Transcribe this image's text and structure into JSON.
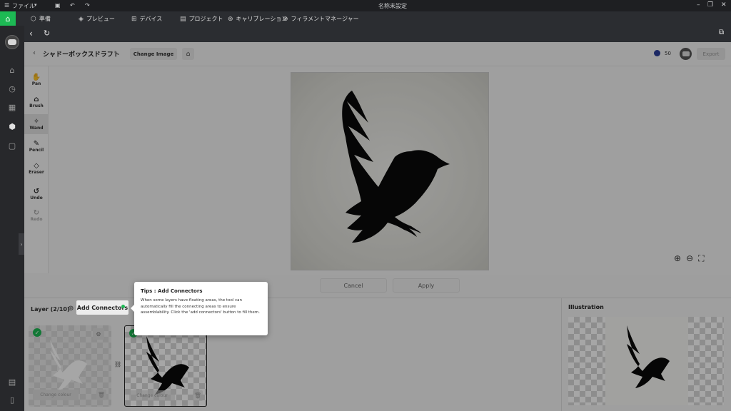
{
  "titlebar": {
    "menu_label": "ファイル",
    "window_title": "名称未設定"
  },
  "menubar": {
    "tabs": [
      {
        "label": "準備",
        "icon": "box-icon"
      },
      {
        "label": "プレビュー",
        "icon": "layers-icon"
      },
      {
        "label": "デバイス",
        "icon": "device-icon"
      },
      {
        "label": "プロジェクト",
        "icon": "project-icon"
      },
      {
        "label": "キャリブレーション",
        "icon": "calibration-icon"
      },
      {
        "label": "フィラメントマネージャー",
        "icon": "filament-icon"
      }
    ]
  },
  "toolbar": {
    "title": "シャドーボックスドラフト",
    "change_image": "Change Image",
    "credits": "50",
    "export": "Export"
  },
  "tools": [
    {
      "label": "Pan",
      "icon": "hand-icon"
    },
    {
      "label": "Brush",
      "icon": "brush-icon"
    },
    {
      "label": "Wand",
      "icon": "wand-icon"
    },
    {
      "label": "Pencil",
      "icon": "pencil-icon"
    },
    {
      "label": "Eraser",
      "icon": "eraser-icon"
    },
    {
      "label": "Undo",
      "icon": "undo-icon"
    },
    {
      "label": "Redo",
      "icon": "redo-icon"
    }
  ],
  "actions": {
    "cancel": "Cancel",
    "apply": "Apply"
  },
  "layers": {
    "title": "Layer (2/10)",
    "add_connectors": "Add Connectors",
    "change_colour": "Change colour"
  },
  "illustration": {
    "title": "Illustration"
  },
  "tooltip": {
    "title": "Tips : Add Connectors",
    "body": "When some layers have floating areas, the tool can automatically fill the connecting areas to ensure assemblability. Click the 'add connectors' button to fill them."
  },
  "colors": {
    "accent": "#1db954"
  }
}
